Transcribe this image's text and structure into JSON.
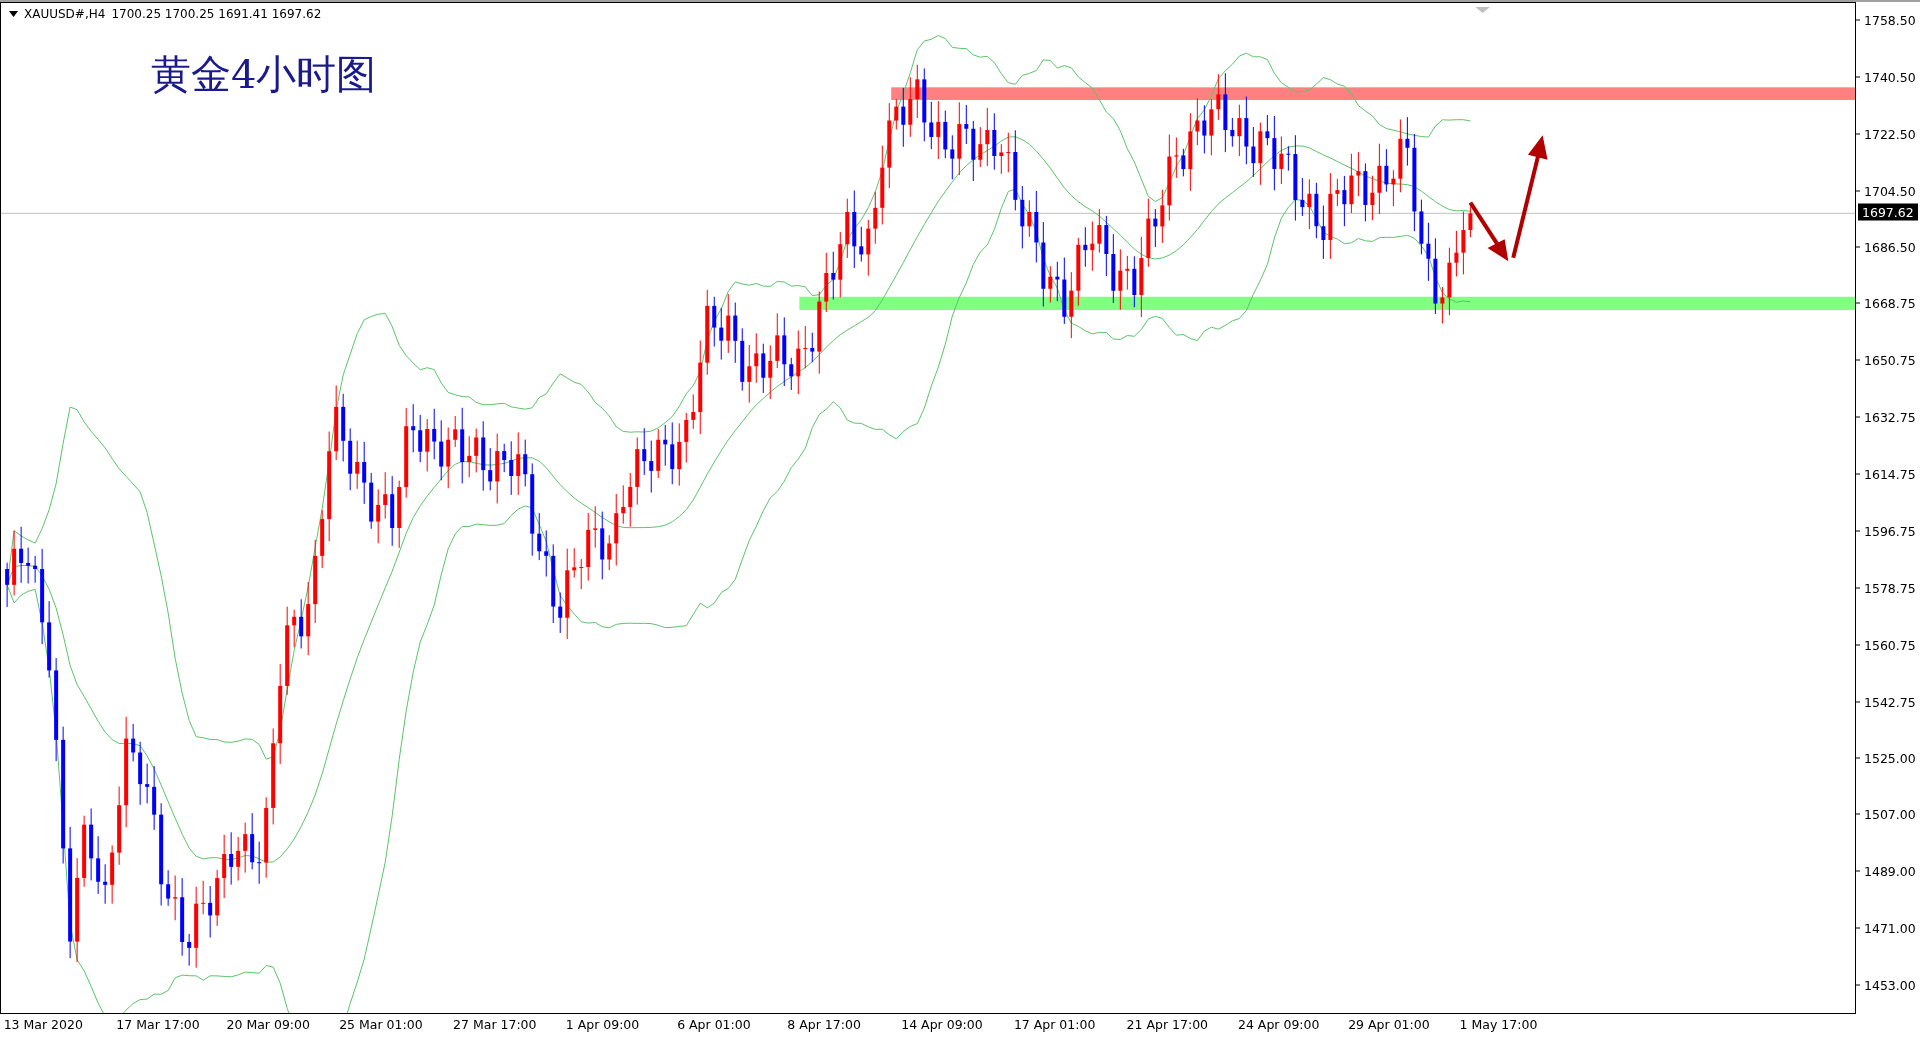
{
  "header": {
    "symbol": "XAUUSD#,H4",
    "quote": "1700.25 1700.25 1691.41 1697.62"
  },
  "title": "黄金4小时图",
  "price_axis": [
    "1758.50",
    "1740.50",
    "1722.50",
    "1704.50",
    "1686.50",
    "1668.75",
    "1650.75",
    "1632.75",
    "1614.75",
    "1596.75",
    "1578.75",
    "1560.75",
    "1542.75",
    "1525.00",
    "1507.00",
    "1489.00",
    "1471.00",
    "1453.00"
  ],
  "current_price": "1697.62",
  "time_axis": [
    "13 Mar 2020",
    "17 Mar 17:00",
    "20 Mar 09:00",
    "25 Mar 01:00",
    "27 Mar 17:00",
    "1 Apr 09:00",
    "6 Apr 01:00",
    "8 Apr 17:00",
    "14 Apr 09:00",
    "17 Apr 01:00",
    "21 Apr 17:00",
    "24 Apr 09:00",
    "29 Apr 01:00",
    "1 May 17:00"
  ]
}
